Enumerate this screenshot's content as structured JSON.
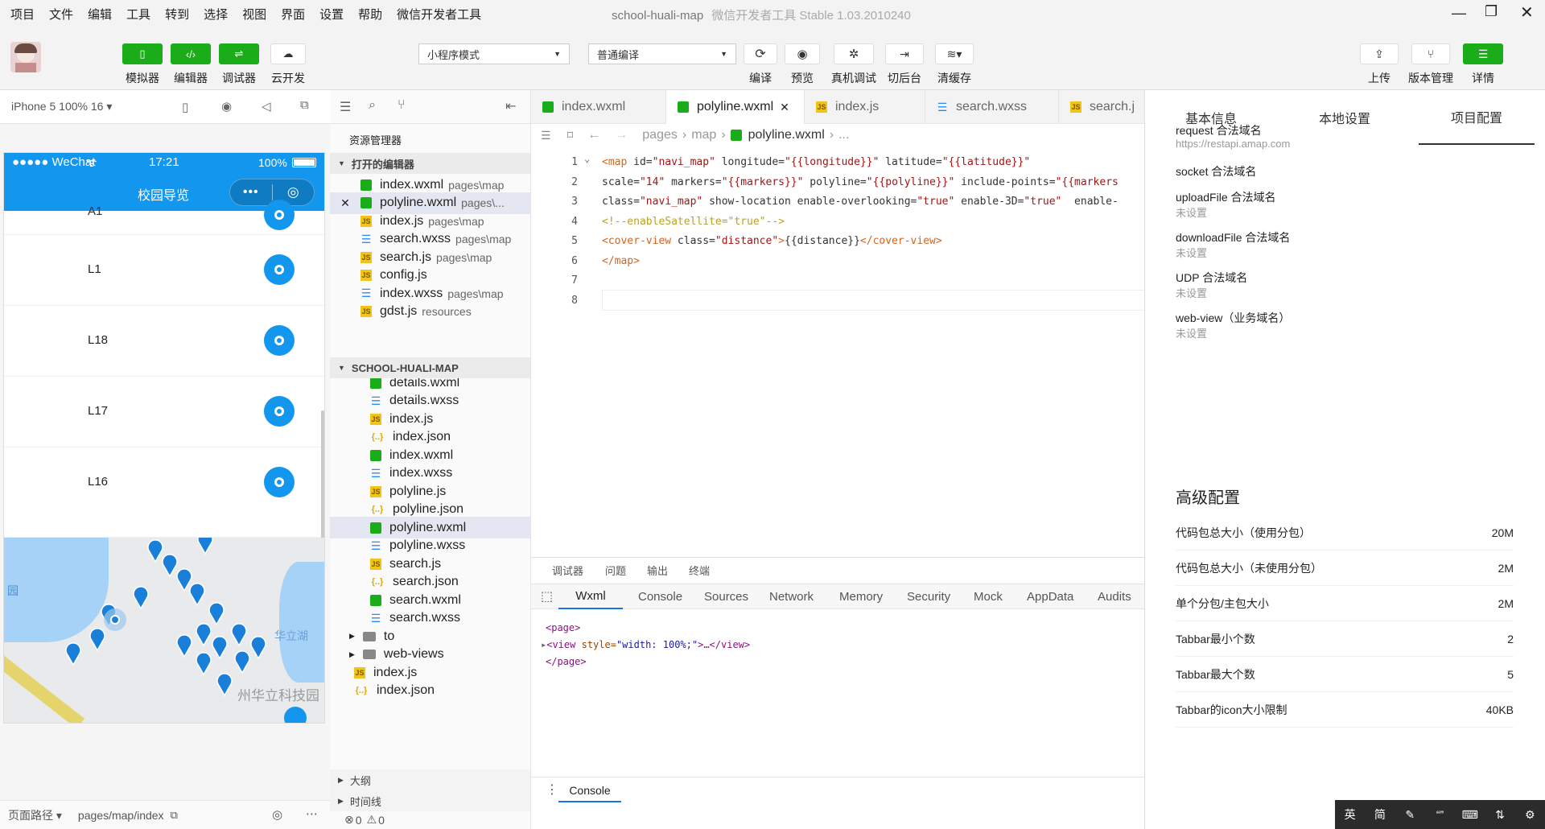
{
  "menu": [
    "项目",
    "文件",
    "编辑",
    "工具",
    "转到",
    "选择",
    "视图",
    "界面",
    "设置",
    "帮助",
    "微信开发者工具"
  ],
  "app_title": "school-huali-map",
  "app_subtitle": "微信开发者工具 Stable 1.03.2010240",
  "toolbar": {
    "simulator": "模拟器",
    "editor": "编辑器",
    "debugger": "调试器",
    "cloud": "云开发",
    "mode_select": "小程序模式",
    "compile_select": "普通编译",
    "compile": "编译",
    "preview": "预览",
    "real_debug": "真机调试",
    "background": "切后台",
    "clear_cache": "清缓存",
    "upload": "上传",
    "version": "版本管理",
    "details": "详情"
  },
  "simulator": {
    "device": "iPhone 5 100% 16 ▾",
    "status_left": "●●●●● WeChat",
    "time": "17:21",
    "battery": "100%",
    "nav_title": "校园导览",
    "partial_row": "A1",
    "rows": [
      "L1",
      "L18",
      "L17",
      "L16"
    ],
    "map_label_lake": "华立湖",
    "map_label_school": "州华立科技园",
    "map_label_left": "园"
  },
  "footer": {
    "page_path_label": "页面路径 ▾",
    "page_path": "pages/map/index",
    "errors": "0",
    "warnings": "0"
  },
  "explorer": {
    "title": "资源管理器",
    "open_editors": "打开的编辑器",
    "open_files": [
      {
        "name": "index.wxml",
        "path": "pages\\map",
        "type": "wx"
      },
      {
        "name": "polyline.wxml",
        "path": "pages\\...",
        "type": "wx"
      },
      {
        "name": "index.js",
        "path": "pages\\map",
        "type": "js"
      },
      {
        "name": "search.wxss",
        "path": "pages\\map",
        "type": "ss"
      },
      {
        "name": "search.js",
        "path": "pages\\map",
        "type": "js"
      },
      {
        "name": "config.js",
        "path": "",
        "type": "js"
      },
      {
        "name": "index.wxss",
        "path": "pages\\map",
        "type": "ss"
      },
      {
        "name": "gdst.js",
        "path": "resources",
        "type": "js"
      }
    ],
    "project": "SCHOOL-HUALI-MAP",
    "tree": [
      {
        "name": "details.wxml",
        "type": "wx",
        "indent": 2
      },
      {
        "name": "details.wxss",
        "type": "ss",
        "indent": 2
      },
      {
        "name": "index.js",
        "type": "js",
        "indent": 2
      },
      {
        "name": "index.json",
        "type": "jn",
        "indent": 2
      },
      {
        "name": "index.wxml",
        "type": "wx",
        "indent": 2
      },
      {
        "name": "index.wxss",
        "type": "ss",
        "indent": 2
      },
      {
        "name": "polyline.js",
        "type": "js",
        "indent": 2
      },
      {
        "name": "polyline.json",
        "type": "jn",
        "indent": 2
      },
      {
        "name": "polyline.wxml",
        "type": "wx",
        "indent": 2
      },
      {
        "name": "polyline.wxss",
        "type": "ss",
        "indent": 2
      },
      {
        "name": "search.js",
        "type": "js",
        "indent": 2
      },
      {
        "name": "search.json",
        "type": "jn",
        "indent": 2
      },
      {
        "name": "search.wxml",
        "type": "wx",
        "indent": 2
      },
      {
        "name": "search.wxss",
        "type": "ss",
        "indent": 2
      },
      {
        "name": "to",
        "type": "fd",
        "indent": 1
      },
      {
        "name": "web-views",
        "type": "fd",
        "indent": 1
      },
      {
        "name": "index.js",
        "type": "js",
        "indent": 1
      },
      {
        "name": "index.json",
        "type": "jn",
        "indent": 1
      }
    ],
    "outline": "大纲",
    "timeline": "时间线"
  },
  "editor": {
    "tabs": [
      "index.wxml",
      "polyline.wxml",
      "index.js",
      "search.wxss",
      "search.j"
    ],
    "crumb": [
      "pages",
      "map",
      "polyline.wxml",
      "..."
    ],
    "line_numbers": [
      "1",
      "2",
      "3",
      "4",
      "5",
      "6",
      "7",
      "8"
    ],
    "lines": {
      "l1a": "<map ",
      "l1b": "id=",
      "l1c": "\"navi_map\"",
      "l1d": " longitude=",
      "l1e": "\"{{longitude}}\"",
      "l1f": " latitude=",
      "l1g": "\"{{latitude}}\"",
      "l2a": "scale=",
      "l2b": "\"14\"",
      "l2c": " markers=",
      "l2d": "\"{{markers}}\"",
      "l2e": " polyline=",
      "l2f": "\"{{polyline}}\"",
      "l2g": " include-points=",
      "l2h": "\"{{markers",
      "l3a": "class=",
      "l3b": "\"navi_map\"",
      "l3c": " show-location enable-overlooking=",
      "l3d": "\"true\"",
      "l3e": " enable-3D=",
      "l3f": "\"true\"",
      "l3g": "  enable-",
      "l4": "<!--enableSatellite=\"true\"-->",
      "l5a": "<cover-view ",
      "l5b": "class=",
      "l5c": "\"distance\"",
      "l5d": ">",
      "l5e": "{{distance}}",
      "l5f": "</cover-view>",
      "l6": "</map>"
    }
  },
  "devtools": {
    "top_tabs": [
      "调试器",
      "问题",
      "输出",
      "终端"
    ],
    "tabs": [
      "Wxml",
      "Console",
      "Sources",
      "Network",
      "Memory",
      "Security",
      "Mock",
      "AppData",
      "Audits"
    ],
    "dom1": "<page>",
    "dom2a": "<view ",
    "dom2b": "style=",
    "dom2c": "\"width: 100%;\"",
    "dom2d": ">…</view>",
    "dom3": "</page>",
    "console_tab": "Console"
  },
  "settings": {
    "tabs": [
      "基本信息",
      "本地设置",
      "项目配置"
    ],
    "domains": [
      {
        "k": "request 合法域名",
        "v": "https://restapi.amap.com"
      },
      {
        "k": "socket 合法域名",
        "v": ""
      },
      {
        "k": "uploadFile 合法域名",
        "v": "未设置"
      },
      {
        "k": "downloadFile 合法域名",
        "v": "未设置"
      },
      {
        "k": "UDP 合法域名",
        "v": "未设置"
      },
      {
        "k": "web-view（业务域名）",
        "v": "未设置"
      }
    ],
    "advanced_title": "高级配置",
    "advanced": [
      {
        "k": "代码包总大小（使用分包）",
        "v": "20M"
      },
      {
        "k": "代码包总大小（未使用分包）",
        "v": "2M"
      },
      {
        "k": "单个分包/主包大小",
        "v": "2M"
      },
      {
        "k": "Tabbar最小个数",
        "v": "2"
      },
      {
        "k": "Tabbar最大个数",
        "v": "5"
      },
      {
        "k": "Tabbar的icon大小限制",
        "v": "40KB"
      }
    ]
  },
  "ime": [
    "英",
    "简"
  ],
  "colors": {
    "wechat_green": "#1aad19",
    "wechat_blue": "#1296ee"
  }
}
